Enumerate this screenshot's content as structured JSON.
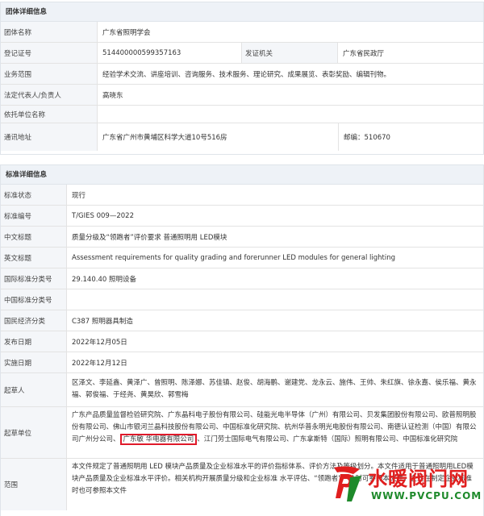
{
  "group": {
    "header": "团体详细信息",
    "name_label": "团体名称",
    "name_value": "广东省照明学会",
    "reg_label": "登记证号",
    "reg_value": "514400000599357163",
    "issuer_label": "发证机关",
    "issuer_value": "广东省民政厅",
    "scope_label": "业务范围",
    "scope_value": "经验学术交流、讲座培训、咨询服务、技术服务、理论研究、成果展览、表彰奖励、编辑刊物。",
    "rep_label": "法定代表人/负责人",
    "rep_value": "高晓东",
    "support_label": "依托单位名称",
    "support_value": "",
    "addr_label": "通讯地址",
    "addr_value": "广东省广州市黄埔区科学大道10号516房",
    "postcode_value": "邮编：510670"
  },
  "standard": {
    "header": "标准详细信息",
    "status_label": "标准状态",
    "status_value": "现行",
    "code_label": "标准编号",
    "code_value": "T/GIES 009—2022",
    "cn_title_label": "中文标题",
    "cn_title_value": "质量分级及“领跑者”评价要求 普通照明用 LED模块",
    "en_title_label": "英文标题",
    "en_title_value": "Assessment requirements for quality grading and forerunner LED modules for general lighting",
    "ics_label": "国际标准分类号",
    "ics_value": "29.140.40 照明设备",
    "ccs_label": "中国标准分类号",
    "ccs_value": "",
    "econ_label": "国民经济分类",
    "econ_value": "C387 照明器具制造",
    "pub_label": "发布日期",
    "pub_value": "2022年12月05日",
    "impl_label": "实施日期",
    "impl_value": "2022年12月12日",
    "drafters_label": "起草人",
    "drafters_value": "区泽文、李延鑫、黄泽广、曾照明、陈泽娜、苏佳镇、赵俊、胡海鹏、谢建党、龙永云、施伟、王帅、朱红旗、徐永嘉、侯乐福、黄永福、郭俊福、于经尧、黄昊欣、郭雪梅",
    "units_label": "起草单位",
    "units_before": "广东产品质量监督检验研究院、广东晶科电子股份有限公司、硅能光电半导体（广州）有限公司、贝发集团股份有限公司、欧普照明股份有限公司、佛山市银河兰晶科技股份有限公司、中国标准化研究院、杭州华普永明光电股份有限公司、南德认证检测（中国）有限公司广州分公司、",
    "units_highlight": "广东敏 华电器有限公司",
    "units_after": "、江门劳士国际电气有限公司、广东拿斯特（国际）照明有限公司、中国标准化研究院",
    "scope2_label": "范围",
    "scope2_value": "本文件规定了普通照明用 LED 模块产品质量及企业标准水平的评价指标体系、评价方法及等级划分。本文件适用于普通照明用LED模块产品质量及企业标准水平评价。相关机构开展质量分级和企业标准 水平评估、“领跑者”评价时可参照本文件，企业在制定企业标准时也可参照本文件"
  },
  "watermark": {
    "title": "水暖阀门网",
    "url": "WWW.PVCPU.COM",
    "logo_icon": "pv-logo-icon",
    "title_color": "#e01e1e",
    "url_color": "#1e8a2b"
  }
}
